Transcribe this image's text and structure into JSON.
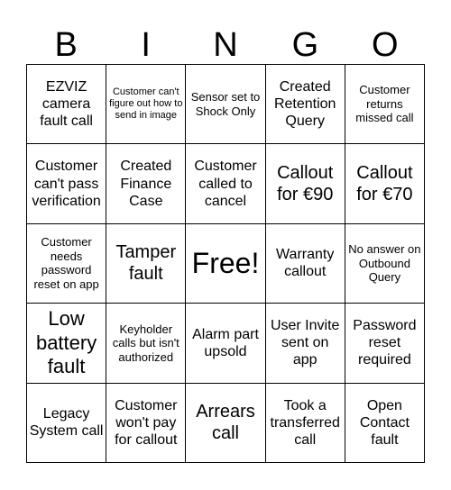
{
  "header": [
    "B",
    "I",
    "N",
    "G",
    "O"
  ],
  "cells": [
    {
      "text": "EZVIZ camera fault call",
      "size": "s16"
    },
    {
      "text": "Customer can't figure out how to send in image",
      "size": "s11"
    },
    {
      "text": "Sensor set to Shock Only",
      "size": "s13"
    },
    {
      "text": "Created Retention Query",
      "size": "s16"
    },
    {
      "text": "Customer returns missed call",
      "size": "s13"
    },
    {
      "text": "Customer can't pass verification",
      "size": "s16"
    },
    {
      "text": "Created Finance Case",
      "size": "s16"
    },
    {
      "text": "Customer called to cancel",
      "size": "s16"
    },
    {
      "text": "Callout for €90",
      "size": "s20"
    },
    {
      "text": "Callout for €70",
      "size": "s20"
    },
    {
      "text": "Customer needs password reset on app",
      "size": "s13"
    },
    {
      "text": "Tamper fault",
      "size": "s20"
    },
    {
      "text": "Free!",
      "size": "s32"
    },
    {
      "text": "Warranty callout",
      "size": "s16"
    },
    {
      "text": "No answer on Outbound Query",
      "size": "s13"
    },
    {
      "text": "Low battery fault",
      "size": "s22"
    },
    {
      "text": "Keyholder calls but isn't authorized",
      "size": "s13"
    },
    {
      "text": "Alarm part upsold",
      "size": "s16"
    },
    {
      "text": "User Invite sent on app",
      "size": "s16"
    },
    {
      "text": "Password reset required",
      "size": "s16"
    },
    {
      "text": "Legacy System call",
      "size": "s16"
    },
    {
      "text": "Customer won't pay for callout",
      "size": "s16"
    },
    {
      "text": "Arrears call",
      "size": "s20"
    },
    {
      "text": "Took a transferred call",
      "size": "s16"
    },
    {
      "text": "Open Contact fault",
      "size": "s16"
    }
  ]
}
